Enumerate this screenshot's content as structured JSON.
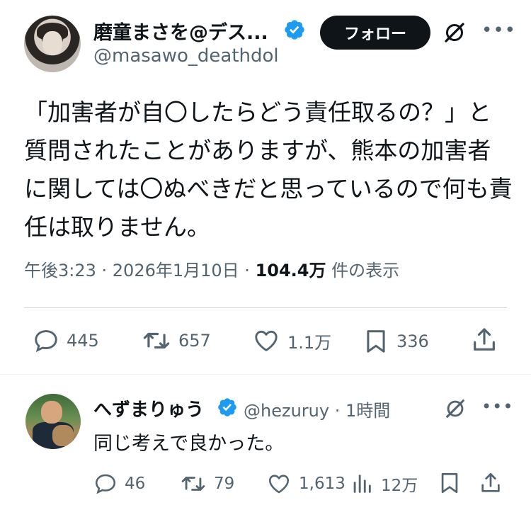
{
  "main_tweet": {
    "author_name": "磨童まさを@デス...",
    "author_handle": "@masawo_deathdol",
    "follow_label": "フォロー",
    "text": "「加害者が自〇したらどう責任取るの？」と質問されたことがありますが、熊本の加害者に関しては〇ぬべきだと思っているので何も責任は取りません。",
    "timestamp": "午後3:23 · 2026年1月10日 · ",
    "views": "104.4万",
    "views_suffix": " 件の表示",
    "replies": "445",
    "retweets": "657",
    "likes": "1.1万",
    "bookmarks": "336"
  },
  "reply": {
    "author_name": "へずまりゅう",
    "author_handle": "@hezuruy · 1時間",
    "text": "同じ考えで良かった。",
    "replies": "46",
    "retweets": "79",
    "likes": "1,613",
    "views": "12万"
  },
  "icons": {
    "verified": "verified-badge-icon",
    "grok": "grok-icon",
    "more": "more-icon",
    "reply": "reply-icon",
    "retweet": "retweet-icon",
    "like": "heart-icon",
    "bookmark": "bookmark-icon",
    "share": "share-icon",
    "views": "analytics-icon"
  },
  "colors": {
    "verified": "#1d9bf0",
    "text": "#0f1419",
    "secondary": "#536471",
    "follow_bg": "#0f1419"
  }
}
